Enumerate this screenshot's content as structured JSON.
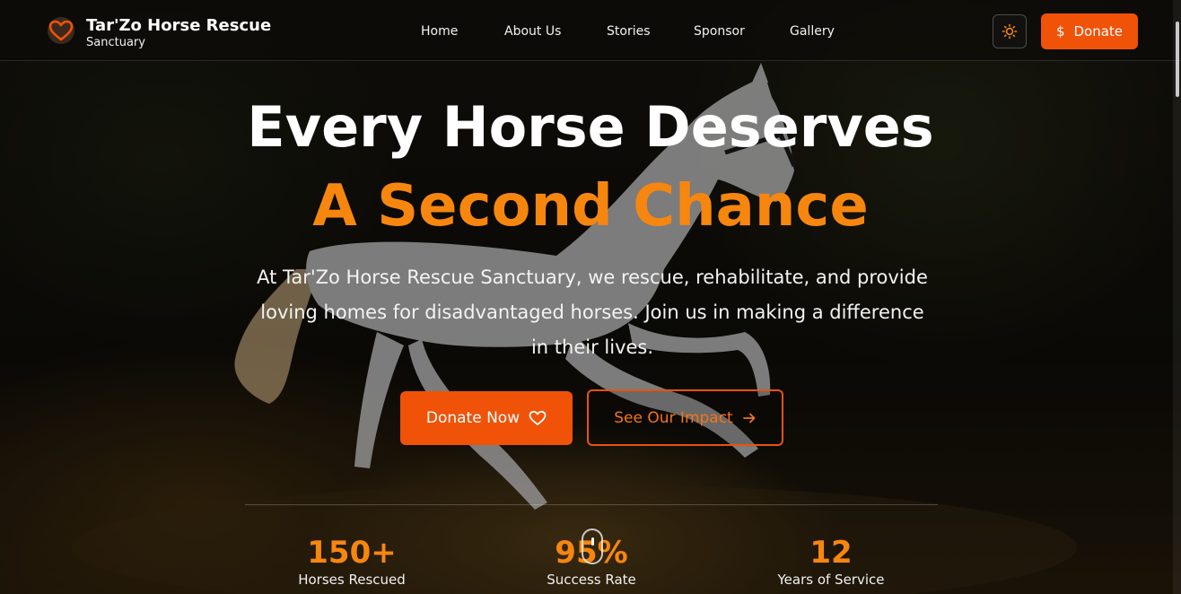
{
  "brand": {
    "name": "Tar'Zo Horse Rescue",
    "tagline": "Sanctuary",
    "logo_icon": "heart-icon"
  },
  "nav": {
    "links": [
      {
        "label": "Home"
      },
      {
        "label": "About Us"
      },
      {
        "label": "Stories"
      },
      {
        "label": "Sponsor"
      },
      {
        "label": "Gallery"
      }
    ],
    "theme_toggle_icon": "sun-icon",
    "donate_label": "Donate",
    "donate_icon": "dollar-icon"
  },
  "hero": {
    "title_line1": "Every Horse Deserves",
    "title_line2": "A Second Chance",
    "description": "At Tar'Zo Horse Rescue Sanctuary, we rescue, rehabilitate, and provide loving homes for disadvantaged horses. Join us in making a difference in their lives.",
    "primary_cta": {
      "label": "Donate Now",
      "icon": "heart-outline-icon"
    },
    "secondary_cta": {
      "label": "See Our Impact",
      "icon": "arrow-right-icon"
    }
  },
  "stats": [
    {
      "value": "150+",
      "label": "Horses Rescued"
    },
    {
      "value": "95%",
      "label": "Success Rate"
    },
    {
      "value": "12",
      "label": "Years of Service"
    }
  ],
  "colors": {
    "accent": "#f05208",
    "highlight": "#f7860f",
    "background": "#0b0a08"
  }
}
